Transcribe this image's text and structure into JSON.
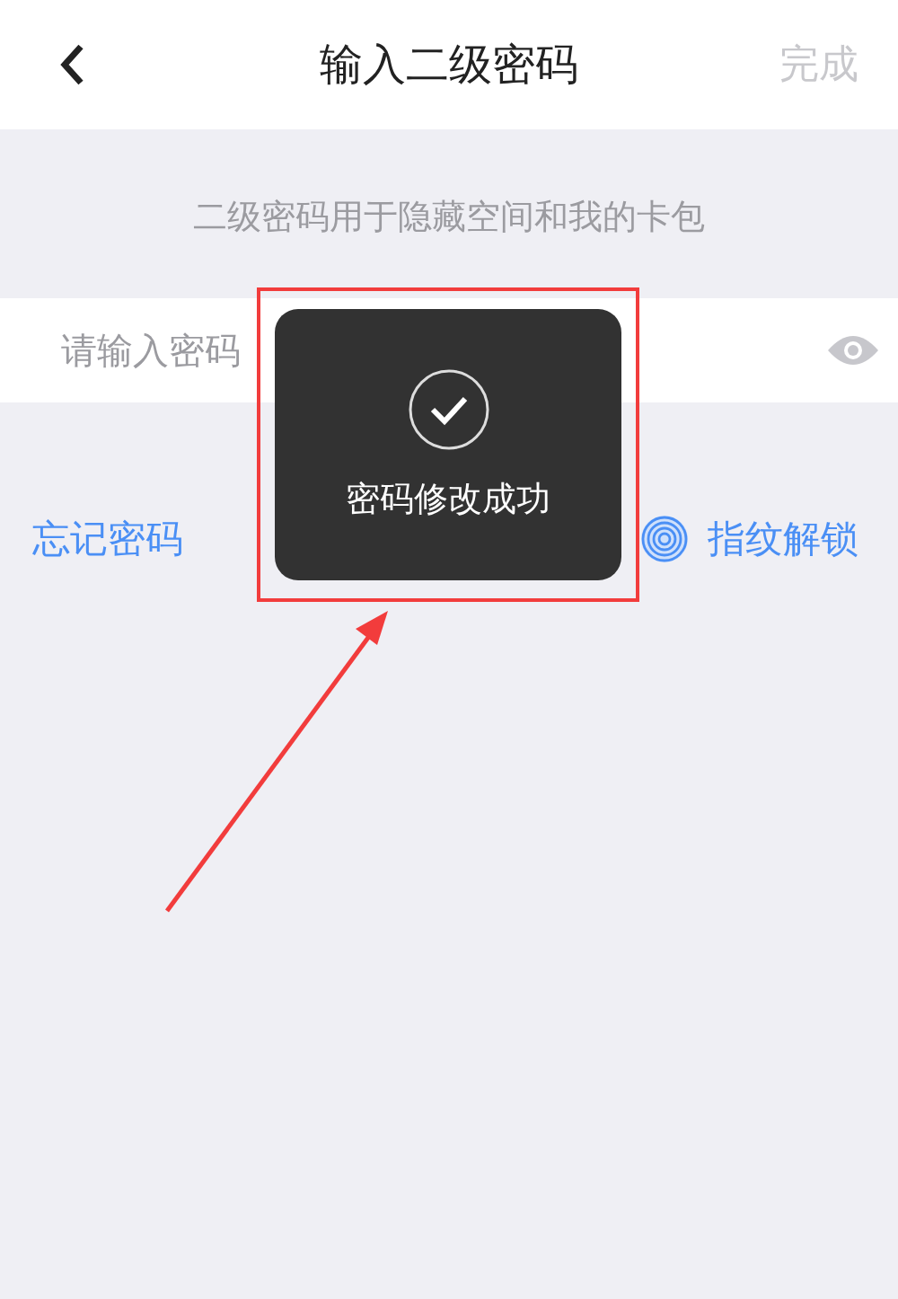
{
  "nav_bar": {
    "title": "输入二级密码",
    "done_button": {
      "label": "完成",
      "disabled": true
    }
  },
  "hint": "二级密码用于隐藏空间和我的卡包",
  "password_field": {
    "placeholder": "请输入密码"
  },
  "links": {
    "forgot": "忘记密码",
    "fingerprint": "指纹解锁"
  },
  "toast": {
    "message": "密码修改成功"
  }
}
